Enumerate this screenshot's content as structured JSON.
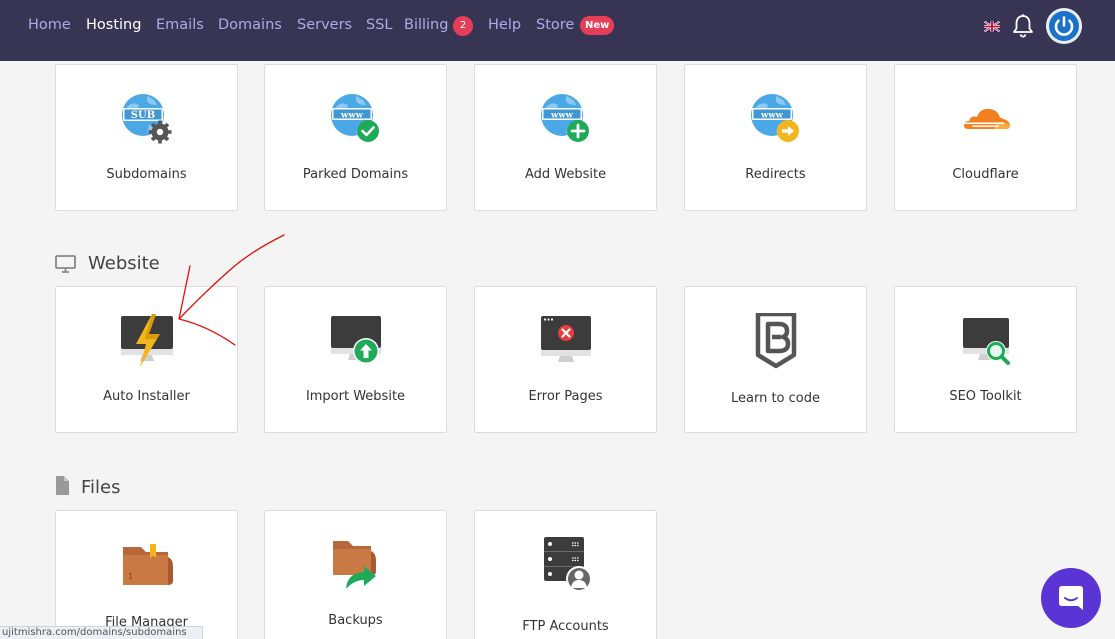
{
  "nav": {
    "items": [
      {
        "label": "Home",
        "active": false
      },
      {
        "label": "Hosting",
        "active": true
      },
      {
        "label": "Emails",
        "active": false
      },
      {
        "label": "Domains",
        "active": false
      },
      {
        "label": "Servers",
        "active": false
      },
      {
        "label": "SSL",
        "active": false
      },
      {
        "label": "Billing",
        "active": false
      },
      {
        "label": "Help",
        "active": false
      },
      {
        "label": "Store",
        "active": false
      }
    ],
    "billing_badge": "2",
    "store_badge": "New",
    "language_flag": "uk-flag-icon",
    "notification_icon": "bell-icon",
    "account_icon": "power-avatar-icon"
  },
  "domains_section": {
    "cards": [
      {
        "label": "Subdomains",
        "icon": "sub-globe-gear-icon"
      },
      {
        "label": "Parked Domains",
        "icon": "www-globe-check-icon"
      },
      {
        "label": "Add Website",
        "icon": "www-globe-plus-icon"
      },
      {
        "label": "Redirects",
        "icon": "www-globe-arrow-icon"
      },
      {
        "label": "Cloudflare",
        "icon": "cloudflare-icon"
      }
    ]
  },
  "website_section": {
    "title": "Website",
    "icon": "monitor-icon",
    "cards": [
      {
        "label": "Auto Installer",
        "icon": "monitor-lightning-icon"
      },
      {
        "label": "Import Website",
        "icon": "monitor-upload-icon"
      },
      {
        "label": "Error Pages",
        "icon": "browser-error-icon"
      },
      {
        "label": "Learn to code",
        "icon": "bootstrap-shield-icon"
      },
      {
        "label": "SEO Toolkit",
        "icon": "monitor-search-icon"
      }
    ]
  },
  "files_section": {
    "title": "Files",
    "icon": "file-icon",
    "cards": [
      {
        "label": "File Manager",
        "icon": "folder-icon"
      },
      {
        "label": "Backups",
        "icon": "folder-share-icon"
      },
      {
        "label": "FTP Accounts",
        "icon": "server-user-icon"
      }
    ]
  },
  "status_bar": {
    "url": "ujitmishra.com/domains/subdomains"
  },
  "chat": {
    "icon": "chat-bubble-icon"
  },
  "colors": {
    "nav_bg": "#373553",
    "nav_text": "#b4a6e8",
    "badge": "#e63e58",
    "chat": "#5b34d6",
    "globe": "#4aa8e6",
    "cloudflare": "#f38020",
    "annotation": "#e01010"
  }
}
